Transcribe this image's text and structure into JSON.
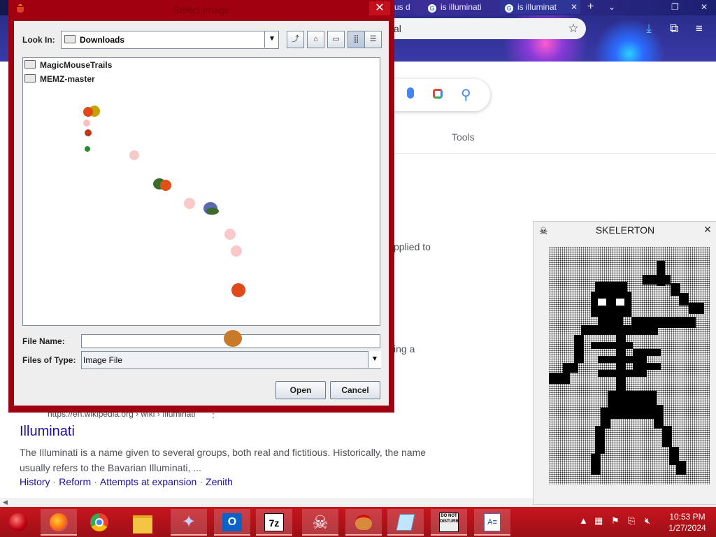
{
  "browser": {
    "tabs": [
      {
        "label": "us d",
        "active": false
      },
      {
        "label": "is illuminati",
        "active": false
      },
      {
        "label": "is illuminat",
        "active": true
      }
    ],
    "omnibox_text": "al",
    "search_tools_label": "Tools",
    "snippet_fragment_1": "pplied to",
    "snippet_fragment_2": "ing a",
    "result": {
      "url": "https://en.wikipedia.org › wiki › Illuminati",
      "title": "Illuminati",
      "description": "The Illuminati is a name given to several groups, both real and fictitious. Historically, the name usually refers to the Bavarian Illuminati, ...",
      "links": [
        "History",
        "Reform",
        "Attempts at expansion",
        "Zenith"
      ]
    }
  },
  "dialog": {
    "title": "Select Image",
    "look_in_label": "Look In:",
    "look_in_value": "Downloads",
    "files": [
      "MagicMouseTrails",
      "MEMZ-master"
    ],
    "file_name_label": "File Name:",
    "file_name_value": "",
    "files_of_type_label": "Files of Type:",
    "files_of_type_value": "Image File",
    "open_label": "Open",
    "cancel_label": "Cancel"
  },
  "skelerton": {
    "title": "SKELERTON"
  },
  "taskbar": {
    "icons": [
      "start-orb-icon",
      "firefox-icon",
      "chrome-icon",
      "file-explorer-icon",
      "cursor-app-icon",
      "outlook-icon",
      "7zip-icon",
      "skull-icon",
      "chicken-icon",
      "notepad-icon",
      "do-not-disturb-icon",
      "wordpad-icon"
    ],
    "time": "10:53 PM",
    "date": "1/27/2024"
  },
  "colors": {
    "dialog_frame": "#a00010",
    "taskbar": "#b0121a",
    "link": "#1a0dab"
  }
}
